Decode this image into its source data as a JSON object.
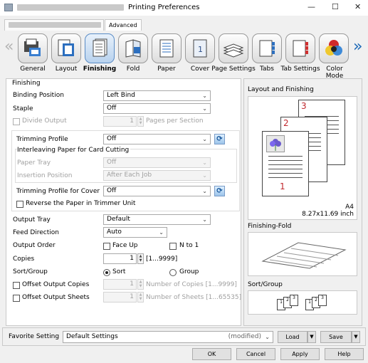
{
  "window": {
    "title": "Printing Preferences",
    "minimize": "—",
    "maximize": "☐",
    "close": "✕"
  },
  "tabs": {
    "first": "",
    "advanced": "Advanced"
  },
  "toolbar": [
    {
      "label": "General",
      "icon": "general-icon"
    },
    {
      "label": "Layout",
      "icon": "layout-icon"
    },
    {
      "label": "Finishing",
      "icon": "finishing-icon"
    },
    {
      "label": "Fold",
      "icon": "fold-icon"
    },
    {
      "label": "Paper",
      "icon": "paper-icon"
    },
    {
      "label": "Cover",
      "icon": "cover-icon"
    },
    {
      "label": "Page Settings",
      "icon": "page-settings-icon"
    },
    {
      "label": "Tabs",
      "icon": "tabs-icon"
    },
    {
      "label": "Tab Settings",
      "icon": "tab-settings-icon"
    },
    {
      "label": "Color Mode",
      "icon": "color-mode-icon"
    }
  ],
  "toolbar_cover_digit": "1",
  "finishing": {
    "section": "Finishing",
    "binding_position": {
      "label": "Binding Position",
      "value": "Left Bind"
    },
    "staple": {
      "label": "Staple",
      "value": "Off"
    },
    "divide_output": {
      "label": "Divide Output",
      "value": "1",
      "unit": "Pages per Section"
    },
    "trimming_profile": {
      "label": "Trimming Profile",
      "value": "Off"
    },
    "interleaving": {
      "label": "Interleaving Paper for Card Cutting"
    },
    "paper_tray": {
      "label": "Paper Tray",
      "value": "Off"
    },
    "insertion_position": {
      "label": "Insertion Position",
      "value": "After Each Job"
    },
    "trimming_profile_cover": {
      "label": "Trimming Profile for Cover",
      "value": "Off"
    },
    "reverse_paper": {
      "label": "Reverse the Paper in Trimmer Unit"
    },
    "output_tray": {
      "label": "Output Tray",
      "value": "Default"
    },
    "feed_direction": {
      "label": "Feed Direction",
      "value": "Auto"
    },
    "output_order": {
      "label": "Output Order",
      "face_up": "Face Up",
      "n_to_1": "N to 1"
    },
    "copies": {
      "label": "Copies",
      "value": "1",
      "range": "[1...9999]"
    },
    "sort_group": {
      "label": "Sort/Group",
      "sort": "Sort",
      "group": "Group"
    },
    "offset_copies": {
      "label": "Offset Output Copies",
      "value": "1",
      "unit": "Number of Copies [1...9999]"
    },
    "offset_sheets": {
      "label": "Offset Output Sheets",
      "value": "1",
      "unit": "Number of Sheets [1...65535]"
    }
  },
  "preview": {
    "layout_title": "Layout and Finishing",
    "page_numbers": [
      "3",
      "2",
      "1"
    ],
    "paper_size": "A4",
    "paper_dims": "8.27x11.69 inch",
    "fold_title": "Finishing-Fold",
    "sort_title": "Sort/Group",
    "sort_digits": [
      "1",
      "2",
      "3",
      "1",
      "2",
      "3"
    ]
  },
  "footer": {
    "favorite_label": "Favorite Setting",
    "favorite_value": "Default Settings",
    "favorite_state": "(modified)",
    "load": "Load",
    "save": "Save",
    "ok": "OK",
    "cancel": "Cancel",
    "apply": "Apply",
    "help": "Help"
  },
  "colors": {
    "accent": "#1e6ab8",
    "red_number": "#c0272d"
  }
}
